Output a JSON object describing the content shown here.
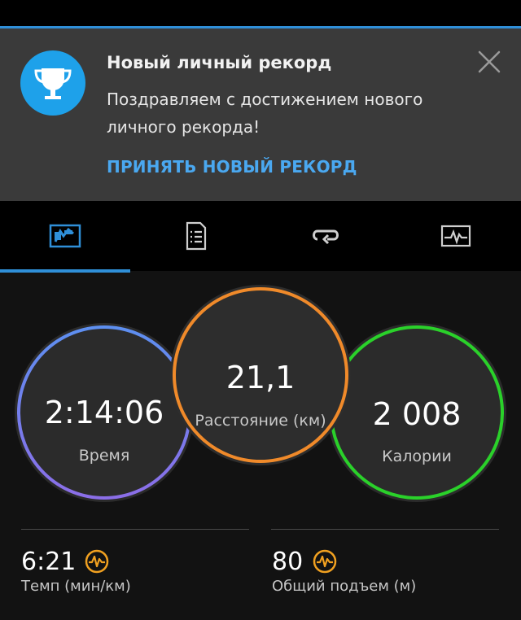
{
  "notification": {
    "title": "Новый личный рекорд",
    "message": "Поздравляем с достижением нового личного рекорда!",
    "action_label": "ПРИНЯТЬ НОВЫЙ РЕКОРД",
    "icon": "trophy-icon"
  },
  "tabs": [
    {
      "icon": "running-stats-icon",
      "selected": true
    },
    {
      "icon": "document-list-icon",
      "selected": false
    },
    {
      "icon": "laps-loop-icon",
      "selected": false
    },
    {
      "icon": "chart-activity-icon",
      "selected": false
    }
  ],
  "metrics": {
    "time": {
      "value": "2:14:06",
      "label": "Время",
      "color": "#7b6ef0"
    },
    "distance": {
      "value": "21,1",
      "label": "Расстояние (км)",
      "color": "#f08a2a"
    },
    "calories": {
      "value": "2 008",
      "label": "Калории",
      "color": "#2ad12a"
    }
  },
  "stats": [
    {
      "value": "6:21",
      "label": "Темп (мин/км)",
      "icon": "heartbeat-icon"
    },
    {
      "value": "80",
      "label": "Общий подъем (м)",
      "icon": "heartbeat-icon"
    }
  ],
  "colors": {
    "accent": "#2f8fd8",
    "link": "#4aa8f0",
    "badge": "#f0a020"
  }
}
